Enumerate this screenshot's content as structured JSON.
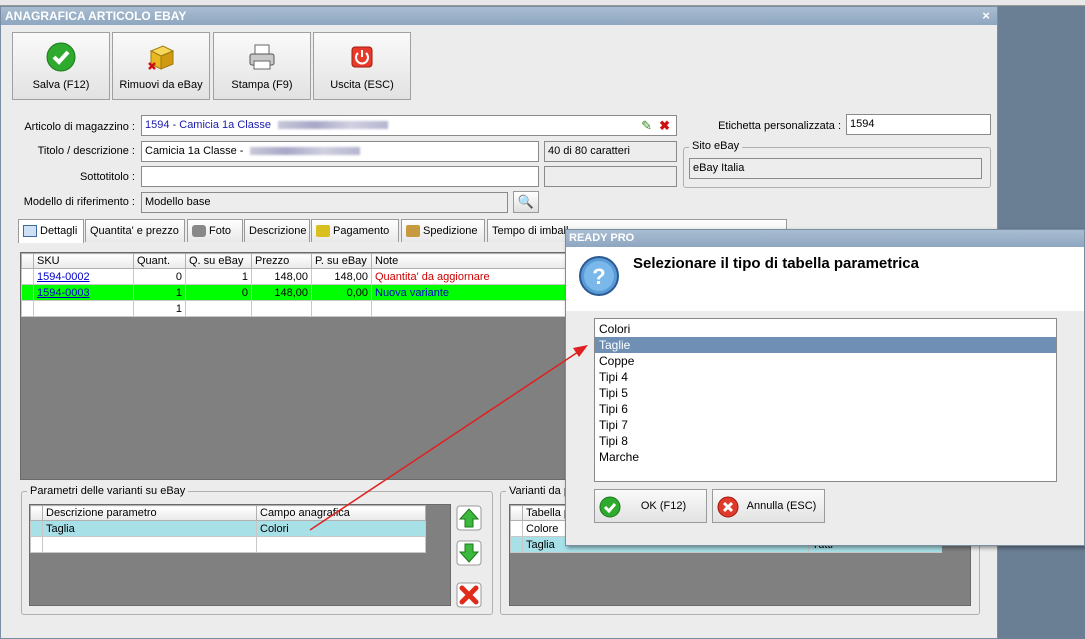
{
  "main_window": {
    "title": "ANAGRAFICA ARTICOLO EBAY",
    "close_glyph": "×"
  },
  "toolbar": {
    "save": "Salva (F12)",
    "remove": "Rimuovi da eBay",
    "print": "Stampa (F9)",
    "exit": "Uscita (ESC)"
  },
  "form": {
    "articolo_label": "Articolo di magazzino :",
    "articolo_value": "1594 - Camicia 1a Classe",
    "titolo_label": "Titolo / descrizione :",
    "titolo_value": "Camicia 1a Classe -",
    "char_counter": "40 di 80 caratteri",
    "sottotitolo_label": "Sottotitolo :",
    "sottotitolo_value": "",
    "modello_label": "Modello di riferimento :",
    "modello_value": "Modello base",
    "etichetta_label": "Etichetta personalizzata :",
    "etichetta_value": "1594",
    "sito_label": "Sito eBay",
    "sito_value": "eBay Italia"
  },
  "tabs": [
    "Dettagli",
    "Quantita' e prezzo",
    "Foto",
    "Descrizione",
    "Pagamento",
    "Spedizione",
    "Tempo di imball"
  ],
  "variants_table": {
    "headers": [
      "SKU",
      "Quant.",
      "Q. su eBay",
      "Prezzo",
      "P. su eBay",
      "Note"
    ],
    "rows": [
      {
        "sku": "1594-0002",
        "qty": "0",
        "qty_ebay": "1",
        "price": "148,00",
        "price_ebay": "148,00",
        "note": "Quantita' da aggiornare"
      },
      {
        "sku": "1594-0003",
        "qty": "1",
        "qty_ebay": "0",
        "price": "148,00",
        "price_ebay": "0,00",
        "note": "Nuova variante"
      },
      {
        "sku": "",
        "qty": "1",
        "qty_ebay": "",
        "price": "",
        "price_ebay": "",
        "note": ""
      }
    ]
  },
  "params_group": {
    "title": "Parametri delle varianti su eBay",
    "headers": [
      "Descrizione parametro",
      "Campo anagrafica"
    ],
    "rows": [
      {
        "desc": "Taglia",
        "field": "Colori"
      }
    ]
  },
  "variants_group": {
    "title": "Varianti da p",
    "header": "Tabella p",
    "rows": [
      {
        "name": "Colore",
        "value": ""
      },
      {
        "name": "Taglia",
        "value": "Tutti"
      }
    ]
  },
  "dialog": {
    "title": "READY PRO",
    "heading": "Selezionare il tipo di tabella parametrica",
    "options": [
      "Colori",
      "Taglie",
      "Coppe",
      "Tipi 4",
      "Tipi 5",
      "Tipi 6",
      "Tipi 7",
      "Tipi 8",
      "Marche"
    ],
    "selected_index": 1,
    "ok": "OK (F12)",
    "cancel": "Annulla (ESC)"
  },
  "colors": {
    "title_bar": "#8ea6c0",
    "selected_row": "#6f8fb4",
    "new_variant_row": "#00ff00",
    "note_red": "#cc0000",
    "arrow": "#e02020"
  }
}
